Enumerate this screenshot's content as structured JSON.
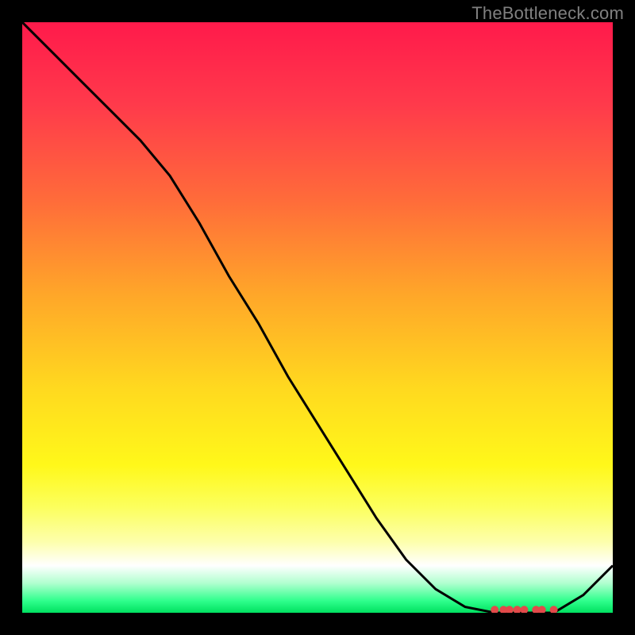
{
  "watermark": "TheBottleneck.com",
  "chart_data": {
    "type": "line",
    "title": "",
    "xlabel": "",
    "ylabel": "",
    "x": [
      0.0,
      0.05,
      0.1,
      0.15,
      0.2,
      0.25,
      0.3,
      0.35,
      0.4,
      0.45,
      0.5,
      0.55,
      0.6,
      0.65,
      0.7,
      0.75,
      0.8,
      0.85,
      0.9,
      0.95,
      1.0
    ],
    "values": [
      1.0,
      0.95,
      0.9,
      0.85,
      0.8,
      0.74,
      0.66,
      0.57,
      0.49,
      0.4,
      0.32,
      0.24,
      0.16,
      0.09,
      0.04,
      0.01,
      0.0,
      0.0,
      0.0,
      0.03,
      0.08
    ],
    "xlim": [
      0,
      1
    ],
    "ylim": [
      0,
      1
    ],
    "line_color": "#000000",
    "line_width": 3,
    "markers": {
      "shape": "circle",
      "color": "#e24a4a",
      "x": [
        0.8,
        0.815,
        0.825,
        0.838,
        0.85,
        0.87,
        0.88,
        0.9
      ],
      "y": [
        0.005,
        0.005,
        0.005,
        0.005,
        0.005,
        0.005,
        0.005,
        0.005
      ]
    },
    "gradient_background": true
  }
}
